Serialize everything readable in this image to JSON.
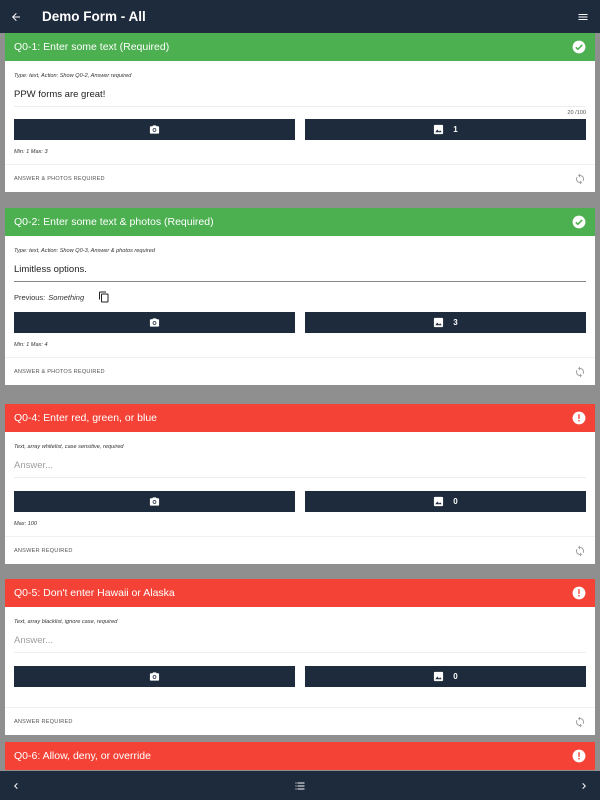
{
  "appbar": {
    "title": "Demo Form - All",
    "back_icon": "arrow-back-icon",
    "menu_icon": "menu-icon"
  },
  "colors": {
    "appbar": "#1e2b3c",
    "complete": "#4caf50",
    "error": "#f44336"
  },
  "questions": [
    {
      "title": "Q0-1: Enter some text (Required)",
      "status_icon": "check-circle-icon",
      "meta": "Type: text, Action: Show Q0-2, Answer required",
      "answer": "PPW forms are great!",
      "counter": "20 /100",
      "photo_count": "1",
      "minmax": "Min: 1 Max: 3",
      "requirement": "Answer & photos required"
    },
    {
      "title": "Q0-2: Enter some text & photos (Required)",
      "status_icon": "check-circle-icon",
      "meta": "Type: text, Action: Show Q0-3, Answer & photos required",
      "answer": "Limitless options.",
      "previous_label": "Previous:",
      "previous_value": "Something",
      "photo_count": "3",
      "minmax": "Min: 1 Max: 4",
      "requirement": "Answer & photos required"
    },
    {
      "title": "Q0-4: Enter red, green, or blue",
      "status_icon": "alert-circle-icon",
      "meta": "Text, array whitelist, case sensitive, required",
      "placeholder": "Answer...",
      "photo_count": "0",
      "minmax": "Max: 100",
      "requirement": "Answer required"
    },
    {
      "title": "Q0-5: Don't enter Hawaii or Alaska",
      "status_icon": "alert-circle-icon",
      "meta": "Text, array blacklist, ignore case, required",
      "placeholder": "Answer...",
      "photo_count": "0",
      "requirement": "Answer required"
    },
    {
      "title": "Q0-6: Allow, deny, or override",
      "status_icon": "alert-circle-icon"
    }
  ],
  "bottombar": {
    "prev_icon": "chevron-left-icon",
    "list_icon": "list-icon",
    "next_icon": "chevron-right-icon"
  }
}
